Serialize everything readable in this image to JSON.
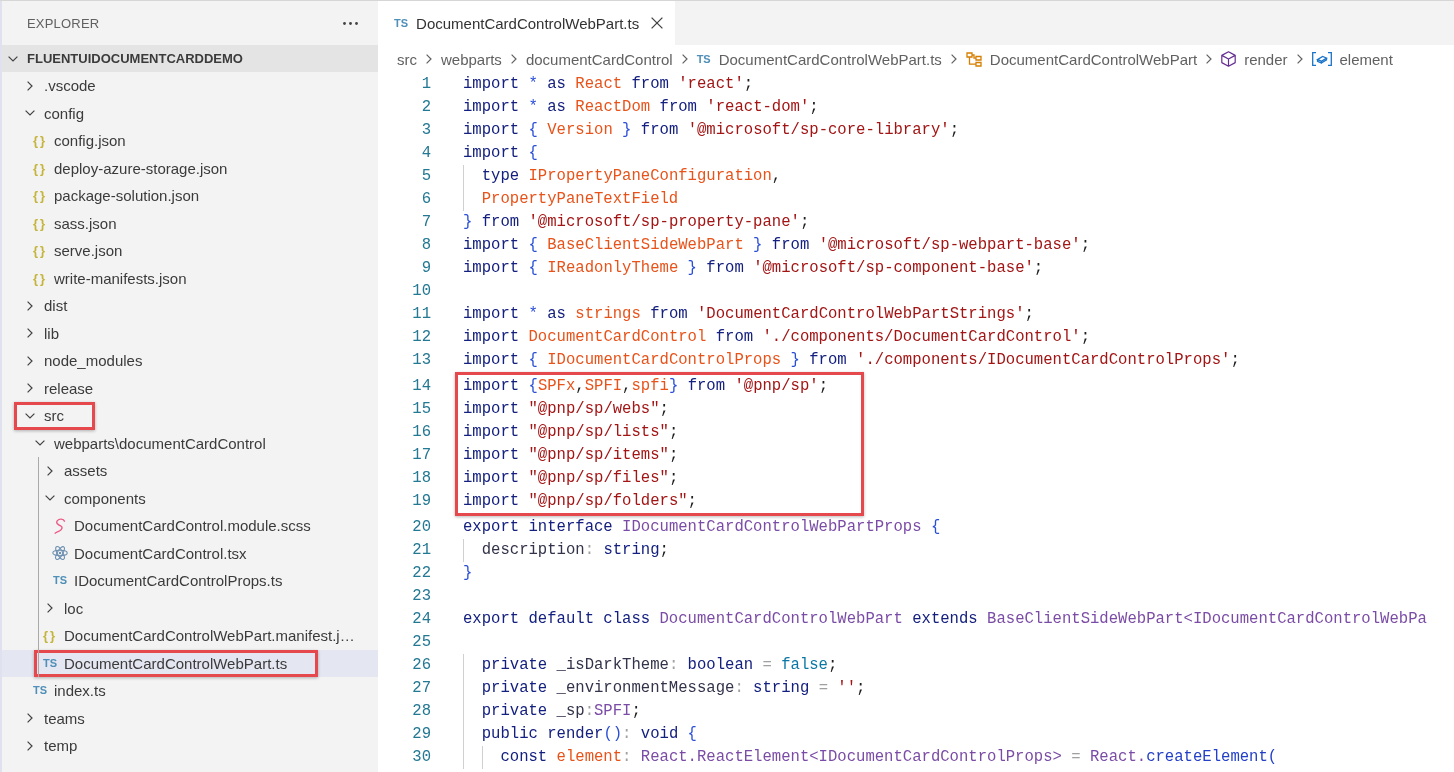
{
  "explorer": {
    "title": "EXPLORER",
    "project": {
      "name": "FLUENTUIDOCUMENTCARDDEMO",
      "expanded": true
    },
    "tree": [
      {
        "label": ".vscode",
        "kind": "folder",
        "expanded": false,
        "selected": false,
        "highlighted": false
      },
      {
        "label": "config",
        "kind": "folder",
        "expanded": true,
        "selected": false,
        "highlighted": false,
        "children": [
          {
            "label": "config.json",
            "kind": "json",
            "icon_text": "{}",
            "selected": false,
            "highlighted": false
          },
          {
            "label": "deploy-azure-storage.json",
            "kind": "json",
            "icon_text": "{}",
            "selected": false,
            "highlighted": false
          },
          {
            "label": "package-solution.json",
            "kind": "json",
            "icon_text": "{}",
            "selected": false,
            "highlighted": false
          },
          {
            "label": "sass.json",
            "kind": "json",
            "icon_text": "{}",
            "selected": false,
            "highlighted": false
          },
          {
            "label": "serve.json",
            "kind": "json",
            "icon_text": "{}",
            "selected": false,
            "highlighted": false
          },
          {
            "label": "write-manifests.json",
            "kind": "json",
            "icon_text": "{}",
            "selected": false,
            "highlighted": false
          }
        ]
      },
      {
        "label": "dist",
        "kind": "folder",
        "expanded": false,
        "selected": false,
        "highlighted": false
      },
      {
        "label": "lib",
        "kind": "folder",
        "expanded": false,
        "selected": false,
        "highlighted": false
      },
      {
        "label": "node_modules",
        "kind": "folder",
        "expanded": false,
        "selected": false,
        "highlighted": false
      },
      {
        "label": "release",
        "kind": "folder",
        "expanded": false,
        "selected": false,
        "highlighted": false
      },
      {
        "label": "src",
        "kind": "folder",
        "expanded": true,
        "selected": false,
        "highlighted": true,
        "children": [
          {
            "label": "webparts\\documentCardControl",
            "kind": "folder",
            "expanded": true,
            "selected": false,
            "highlighted": false,
            "children": [
              {
                "label": "assets",
                "kind": "folder",
                "expanded": false,
                "selected": false,
                "highlighted": false
              },
              {
                "label": "components",
                "kind": "folder",
                "expanded": true,
                "selected": false,
                "highlighted": false,
                "children": [
                  {
                    "label": "DocumentCardControl.module.scss",
                    "kind": "scss",
                    "selected": false,
                    "highlighted": false
                  },
                  {
                    "label": "DocumentCardControl.tsx",
                    "kind": "react",
                    "selected": false,
                    "highlighted": false
                  },
                  {
                    "label": "IDocumentCardControlProps.ts",
                    "kind": "ts",
                    "icon_text": "TS",
                    "selected": false,
                    "highlighted": false
                  }
                ]
              },
              {
                "label": "loc",
                "kind": "folder",
                "expanded": false,
                "selected": false,
                "highlighted": false
              },
              {
                "label": "DocumentCardControlWebPart.manifest.j…",
                "kind": "json",
                "icon_text": "{}",
                "selected": false,
                "highlighted": false
              },
              {
                "label": "DocumentCardControlWebPart.ts",
                "kind": "ts",
                "icon_text": "TS",
                "selected": true,
                "highlighted": true
              }
            ]
          },
          {
            "label": "index.ts",
            "kind": "ts",
            "icon_text": "TS",
            "selected": false,
            "highlighted": false
          }
        ]
      },
      {
        "label": "teams",
        "kind": "folder",
        "expanded": false,
        "selected": false,
        "highlighted": false
      },
      {
        "label": "temp",
        "kind": "folder",
        "expanded": false,
        "selected": false,
        "highlighted": false
      }
    ]
  },
  "tabs": [
    {
      "label": "DocumentCardControlWebPart.ts",
      "kind": "ts",
      "icon_text": "TS",
      "selected": true
    }
  ],
  "breadcrumb": [
    {
      "label": "src",
      "kind": "folder"
    },
    {
      "label": "webparts",
      "kind": "folder"
    },
    {
      "label": "documentCardControl",
      "kind": "folder"
    },
    {
      "label": "DocumentCardControlWebPart.ts",
      "kind": "ts",
      "icon_text": "TS"
    },
    {
      "label": "DocumentCardControlWebPart",
      "kind": "class"
    },
    {
      "label": "render",
      "kind": "method"
    },
    {
      "label": "element",
      "kind": "variable"
    }
  ],
  "editor": {
    "lines": [
      {
        "number": "1",
        "highlighted": false,
        "tokens": [
          {
            "kind": "keyword",
            "text": "import "
          },
          {
            "kind": "punct",
            "text": "* "
          },
          {
            "kind": "keyword",
            "text": "as "
          },
          {
            "kind": "name",
            "text": "React "
          },
          {
            "kind": "keyword",
            "text": "from "
          },
          {
            "kind": "string",
            "text": "'react'"
          },
          {
            "kind": "plain",
            "text": ";"
          }
        ]
      },
      {
        "number": "2",
        "highlighted": false,
        "tokens": [
          {
            "kind": "keyword",
            "text": "import "
          },
          {
            "kind": "punct",
            "text": "* "
          },
          {
            "kind": "keyword",
            "text": "as "
          },
          {
            "kind": "name",
            "text": "ReactDom "
          },
          {
            "kind": "keyword",
            "text": "from "
          },
          {
            "kind": "string",
            "text": "'react-dom'"
          },
          {
            "kind": "plain",
            "text": ";"
          }
        ]
      },
      {
        "number": "3",
        "highlighted": false,
        "tokens": [
          {
            "kind": "keyword",
            "text": "import "
          },
          {
            "kind": "punct",
            "text": "{ "
          },
          {
            "kind": "name",
            "text": "Version "
          },
          {
            "kind": "punct",
            "text": "} "
          },
          {
            "kind": "keyword",
            "text": "from "
          },
          {
            "kind": "string",
            "text": "'@microsoft/sp-core-library'"
          },
          {
            "kind": "plain",
            "text": ";"
          }
        ]
      },
      {
        "number": "4",
        "highlighted": false,
        "tokens": [
          {
            "kind": "keyword",
            "text": "import "
          },
          {
            "kind": "punct",
            "text": "{"
          }
        ]
      },
      {
        "number": "5",
        "highlighted": false,
        "tokens": [
          {
            "kind": "keyword",
            "text": "  type "
          },
          {
            "kind": "name",
            "text": "IPropertyPaneConfiguration"
          },
          {
            "kind": "plain",
            "text": ","
          }
        ]
      },
      {
        "number": "6",
        "highlighted": false,
        "tokens": [
          {
            "kind": "name",
            "text": "  PropertyPaneTextField"
          }
        ]
      },
      {
        "number": "7",
        "highlighted": false,
        "tokens": [
          {
            "kind": "punct",
            "text": "} "
          },
          {
            "kind": "keyword",
            "text": "from "
          },
          {
            "kind": "string",
            "text": "'@microsoft/sp-property-pane'"
          },
          {
            "kind": "plain",
            "text": ";"
          }
        ]
      },
      {
        "number": "8",
        "highlighted": false,
        "tokens": [
          {
            "kind": "keyword",
            "text": "import "
          },
          {
            "kind": "punct",
            "text": "{ "
          },
          {
            "kind": "name",
            "text": "BaseClientSideWebPart "
          },
          {
            "kind": "punct",
            "text": "} "
          },
          {
            "kind": "keyword",
            "text": "from "
          },
          {
            "kind": "string",
            "text": "'@microsoft/sp-webpart-base'"
          },
          {
            "kind": "plain",
            "text": ";"
          }
        ]
      },
      {
        "number": "9",
        "highlighted": false,
        "tokens": [
          {
            "kind": "keyword",
            "text": "import "
          },
          {
            "kind": "punct",
            "text": "{ "
          },
          {
            "kind": "name",
            "text": "IReadonlyTheme "
          },
          {
            "kind": "punct",
            "text": "} "
          },
          {
            "kind": "keyword",
            "text": "from "
          },
          {
            "kind": "string",
            "text": "'@microsoft/sp-component-base'"
          },
          {
            "kind": "plain",
            "text": ";"
          }
        ]
      },
      {
        "number": "10",
        "highlighted": false
      },
      {
        "number": "11",
        "highlighted": false,
        "tokens": [
          {
            "kind": "keyword",
            "text": "import "
          },
          {
            "kind": "punct",
            "text": "* "
          },
          {
            "kind": "keyword",
            "text": "as "
          },
          {
            "kind": "name",
            "text": "strings "
          },
          {
            "kind": "keyword",
            "text": "from "
          },
          {
            "kind": "string",
            "text": "'DocumentCardControlWebPartStrings'"
          },
          {
            "kind": "plain",
            "text": ";"
          }
        ]
      },
      {
        "number": "12",
        "highlighted": false,
        "tokens": [
          {
            "kind": "keyword",
            "text": "import "
          },
          {
            "kind": "name",
            "text": "DocumentCardControl "
          },
          {
            "kind": "keyword",
            "text": "from "
          },
          {
            "kind": "string",
            "text": "'./components/DocumentCardControl'"
          },
          {
            "kind": "plain",
            "text": ";"
          }
        ]
      },
      {
        "number": "13",
        "highlighted": false,
        "tokens": [
          {
            "kind": "keyword",
            "text": "import "
          },
          {
            "kind": "punct",
            "text": "{ "
          },
          {
            "kind": "name",
            "text": "IDocumentCardControlProps "
          },
          {
            "kind": "punct",
            "text": "} "
          },
          {
            "kind": "keyword",
            "text": "from "
          },
          {
            "kind": "string",
            "text": "'./components/IDocumentCardControlProps'"
          },
          {
            "kind": "plain",
            "text": ";"
          }
        ]
      },
      {
        "number": "14",
        "highlighted": true,
        "tokens": [
          {
            "kind": "keyword",
            "text": "import "
          },
          {
            "kind": "punct",
            "text": "{"
          },
          {
            "kind": "name",
            "text": "SPFx"
          },
          {
            "kind": "plain",
            "text": ","
          },
          {
            "kind": "name",
            "text": "SPFI"
          },
          {
            "kind": "plain",
            "text": ","
          },
          {
            "kind": "name",
            "text": "spfi"
          },
          {
            "kind": "punct",
            "text": "} "
          },
          {
            "kind": "keyword",
            "text": "from "
          },
          {
            "kind": "string",
            "text": "'@pnp/sp'"
          },
          {
            "kind": "plain",
            "text": ";"
          }
        ]
      },
      {
        "number": "15",
        "highlighted": true,
        "tokens": [
          {
            "kind": "keyword",
            "text": "import "
          },
          {
            "kind": "string",
            "text": "\"@pnp/sp/webs\""
          },
          {
            "kind": "plain",
            "text": ";"
          }
        ]
      },
      {
        "number": "16",
        "highlighted": true,
        "tokens": [
          {
            "kind": "keyword",
            "text": "import "
          },
          {
            "kind": "string",
            "text": "\"@pnp/sp/lists\""
          },
          {
            "kind": "plain",
            "text": ";"
          }
        ]
      },
      {
        "number": "17",
        "highlighted": true,
        "tokens": [
          {
            "kind": "keyword",
            "text": "import "
          },
          {
            "kind": "string",
            "text": "\"@pnp/sp/items\""
          },
          {
            "kind": "plain",
            "text": ";"
          }
        ]
      },
      {
        "number": "18",
        "highlighted": true,
        "tokens": [
          {
            "kind": "keyword",
            "text": "import "
          },
          {
            "kind": "string",
            "text": "\"@pnp/sp/files\""
          },
          {
            "kind": "plain",
            "text": ";"
          }
        ]
      },
      {
        "number": "19",
        "highlighted": true,
        "tokens": [
          {
            "kind": "keyword",
            "text": "import "
          },
          {
            "kind": "string",
            "text": "\"@pnp/sp/folders\""
          },
          {
            "kind": "plain",
            "text": ";"
          }
        ]
      },
      {
        "number": "20",
        "highlighted": false,
        "tokens": [
          {
            "kind": "keyword",
            "text": "export interface "
          },
          {
            "kind": "type",
            "text": "IDocumentCardControlWebPartProps "
          },
          {
            "kind": "punct",
            "text": "{"
          }
        ]
      },
      {
        "number": "21",
        "highlighted": false,
        "tokens": [
          {
            "kind": "member",
            "text": "  description"
          },
          {
            "kind": "operator",
            "text": ": "
          },
          {
            "kind": "keyword",
            "text": "string"
          },
          {
            "kind": "plain",
            "text": ";"
          }
        ]
      },
      {
        "number": "22",
        "highlighted": false,
        "tokens": [
          {
            "kind": "punct",
            "text": "}"
          }
        ]
      },
      {
        "number": "23",
        "highlighted": false
      },
      {
        "number": "24",
        "highlighted": false,
        "tokens": [
          {
            "kind": "keyword",
            "text": "export default class "
          },
          {
            "kind": "type",
            "text": "DocumentCardControlWebPart "
          },
          {
            "kind": "keyword",
            "text": "extends "
          },
          {
            "kind": "type",
            "text": "BaseClientSideWebPart<IDocumentCardControlWebPa"
          }
        ]
      },
      {
        "number": "25",
        "highlighted": false
      },
      {
        "number": "26",
        "highlighted": false,
        "tokens": [
          {
            "kind": "keyword",
            "text": "  private "
          },
          {
            "kind": "member",
            "text": "_isDarkTheme"
          },
          {
            "kind": "operator",
            "text": ": "
          },
          {
            "kind": "keyword",
            "text": "boolean "
          },
          {
            "kind": "operator",
            "text": "= "
          },
          {
            "kind": "constant",
            "text": "false"
          },
          {
            "kind": "plain",
            "text": ";"
          }
        ]
      },
      {
        "number": "27",
        "highlighted": false,
        "tokens": [
          {
            "kind": "keyword",
            "text": "  private "
          },
          {
            "kind": "member",
            "text": "_environmentMessage"
          },
          {
            "kind": "operator",
            "text": ": "
          },
          {
            "kind": "keyword",
            "text": "string "
          },
          {
            "kind": "operator",
            "text": "= "
          },
          {
            "kind": "string",
            "text": "''"
          },
          {
            "kind": "plain",
            "text": ";"
          }
        ]
      },
      {
        "number": "28",
        "highlighted": false,
        "tokens": [
          {
            "kind": "keyword",
            "text": "  private "
          },
          {
            "kind": "member",
            "text": "_sp"
          },
          {
            "kind": "operator",
            "text": ":"
          },
          {
            "kind": "type",
            "text": "SPFI"
          },
          {
            "kind": "plain",
            "text": ";"
          }
        ]
      },
      {
        "number": "29",
        "highlighted": false,
        "tokens": [
          {
            "kind": "keyword",
            "text": "  public render"
          },
          {
            "kind": "punct",
            "text": "()"
          },
          {
            "kind": "operator",
            "text": ": "
          },
          {
            "kind": "keyword",
            "text": "void "
          },
          {
            "kind": "punct",
            "text": "{"
          }
        ]
      },
      {
        "number": "30",
        "highlighted": false,
        "tokens": [
          {
            "kind": "keyword",
            "text": "    const "
          },
          {
            "kind": "name",
            "text": "element"
          },
          {
            "kind": "operator",
            "text": ": "
          },
          {
            "kind": "type",
            "text": "React.ReactElement<IDocumentCardControlProps> "
          },
          {
            "kind": "operator",
            "text": "= "
          },
          {
            "kind": "type",
            "text": "React."
          },
          {
            "kind": "call",
            "text": "createElement("
          }
        ]
      }
    ]
  }
}
